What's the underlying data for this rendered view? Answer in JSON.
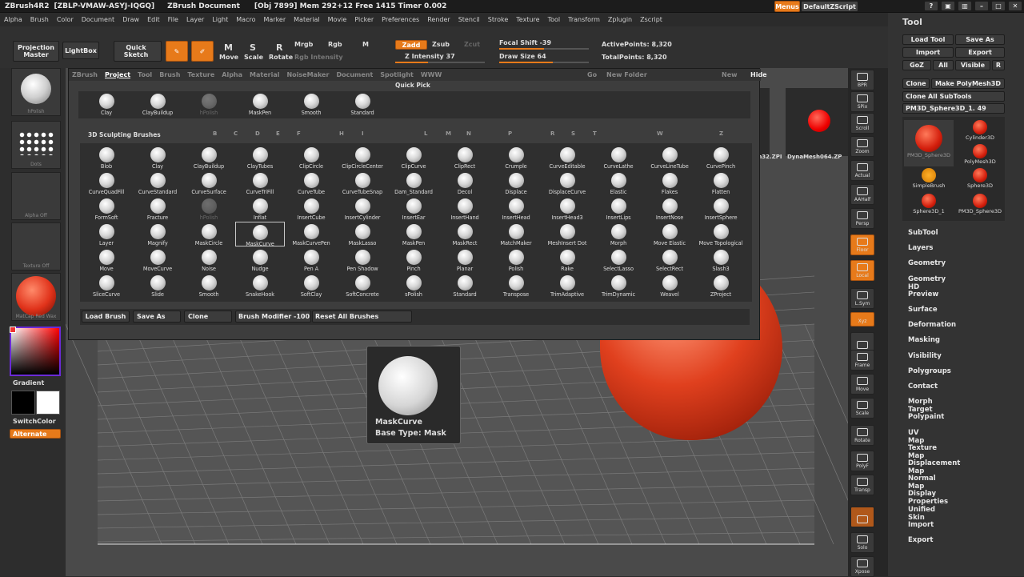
{
  "titlebar": {
    "app": "ZBrush4R2",
    "serial": "[ZBLP-VMAW-ASYJ-IQGQ]",
    "document": "ZBrush Document",
    "stats": "[Obj 7899] Mem 292+12 Free 1415 Timer 0.002",
    "menus_btn": "Menus",
    "script": "DefaultZScript"
  },
  "menubar": [
    "Alpha",
    "Brush",
    "Color",
    "Document",
    "Draw",
    "Edit",
    "File",
    "Layer",
    "Light",
    "Macro",
    "Marker",
    "Material",
    "Movie",
    "Picker",
    "Preferences",
    "Render",
    "Stencil",
    "Stroke",
    "Texture",
    "Tool",
    "Transform",
    "Zplugin",
    "Zscript"
  ],
  "toolbar": {
    "projection_master": "Projection Master",
    "lightbox": "LightBox",
    "quick_sketch": "Quick Sketch",
    "edit": "Edit",
    "draw": "Draw",
    "move": "Move",
    "scale": "Scale",
    "rotate": "Rotate",
    "mrgb": "Mrgb",
    "rgb": "Rgb",
    "m": "M",
    "rgb_intensity": "Rgb Intensity",
    "zadd": "Zadd",
    "zsub": "Zsub",
    "zcut": "Zcut",
    "z_intensity": "Z Intensity 37",
    "focal_shift": "Focal Shift -39",
    "draw_size": "Draw Size 64",
    "active_points": "ActivePoints: 8,320",
    "total_points": "TotalPoints: 8,320"
  },
  "leftshelf": {
    "brush_caption": "hPolish",
    "stroke_caption": "Dots",
    "alpha_caption": "Alpha Off",
    "texture_caption": "Texture Off",
    "material_caption": "MatCap Red Wax",
    "gradient": "Gradient",
    "switch_color": "SwitchColor",
    "alternate": "Alternate"
  },
  "lightbox_tabs": [
    "ZBrush",
    "Project",
    "Tool",
    "Brush",
    "Texture",
    "Alpha",
    "Material",
    "NoiseMaker",
    "Document",
    "Spotlight",
    "WWW"
  ],
  "lightbox_right": [
    "Go",
    "New Folder",
    "New",
    "Hide"
  ],
  "picker": {
    "quick_pick_title": "Quick Pick",
    "quick_pick": [
      "Clay",
      "ClayBuildup",
      "hPolish",
      "MaskPen",
      "Smooth",
      "Standard"
    ],
    "section_title": "3D Sculpting Brushes",
    "letters": [
      "B",
      "C",
      "D",
      "E",
      "F",
      "H",
      "I",
      "L",
      "M",
      "N",
      "P",
      "R",
      "S",
      "T",
      "W",
      "Z"
    ],
    "brushes": [
      [
        "Blob",
        "Clay",
        "ClayBuildup",
        "ClayTubes",
        "ClipCircle",
        "ClipCircleCenter",
        "ClipCurve",
        "ClipRect",
        "Crumple",
        "CurveEditable",
        "CurveLathe",
        "CurveLineTube",
        "CurvePinch"
      ],
      [
        "CurveQuadFill",
        "CurveStandard",
        "CurveSurface",
        "CurveTriFill",
        "CurveTube",
        "CurveTubeSnap",
        "Dam_Standard",
        "Decol",
        "Displace",
        "DisplaceCurve",
        "Elastic",
        "Flakes",
        "Flatten"
      ],
      [
        "FormSoft",
        "Fracture",
        "hPolish",
        "Inflat",
        "InsertCube",
        "InsertCylinder",
        "InsertEar",
        "InsertHand",
        "InsertHead",
        "InsertHead3",
        "InsertLips",
        "InsertNose",
        "InsertSphere"
      ],
      [
        "Layer",
        "Magnify",
        "MaskCircle",
        "MaskCurve",
        "MaskCurvePen",
        "MaskLasso",
        "MaskPen",
        "MaskRect",
        "MatchMaker",
        "MeshInsert Dot",
        "Morph",
        "Move Elastic",
        "Move Topological"
      ],
      [
        "Move",
        "MoveCurve",
        "Noise",
        "Nudge",
        "Pen A",
        "Pen Shadow",
        "Pinch",
        "Planar",
        "Polish",
        "Rake",
        "SelectLasso",
        "SelectRect",
        "Slash3"
      ],
      [
        "SliceCurve",
        "Slide",
        "Smooth",
        "SnakeHook",
        "SoftClay",
        "SoftConcrete",
        "sPolish",
        "Standard",
        "Transpose",
        "TrimAdaptive",
        "TrimDynamic",
        "Weavel",
        "ZProject"
      ]
    ],
    "bottom": {
      "load_brush": "Load Brush",
      "save_as": "Save As",
      "clone": "Clone",
      "brush_modifier": "Brush Modifier -100",
      "reset_all": "Reset All Brushes"
    }
  },
  "tooltip": {
    "name": "MaskCurve",
    "base_type": "Base Type: Mask"
  },
  "viewport_files": {
    "file_a": "...m32.ZPI",
    "file_b": "DynaMesh064.ZP"
  },
  "rightshelf": [
    "BPR",
    "SPix",
    "Scroll",
    "Zoom",
    "Actual",
    "AAHalf",
    "Persp",
    "Floor",
    "Local",
    "L.Sym",
    "Xyz",
    "",
    "Frame",
    "Move",
    "Scale",
    "Rotate",
    "PolyF",
    "Transp",
    "",
    "Solo",
    "Xpose"
  ],
  "tool_panel": {
    "title": "Tool",
    "load_tool": "Load Tool",
    "save_as": "Save As",
    "import": "Import",
    "export": "Export",
    "goz": "GoZ",
    "all": "All",
    "visible": "Visible",
    "r": "R",
    "clone": "Clone",
    "make_polymesh": "Make PolyMesh3D",
    "clone_all": "Clone All SubTools",
    "current_tool": "PM3D_Sphere3D_1. 49",
    "tools": [
      "PM3D_Sphere3D",
      "Cylinder3D",
      "PolyMesh3D",
      "SimpleBrush",
      "Sphere3D",
      "Sphere3D_1",
      "PM3D_Sphere3D"
    ],
    "menu": [
      "SubTool",
      "Layers",
      "Geometry",
      "Geometry HD",
      "Preview",
      "Surface",
      "Deformation",
      "Masking",
      "Visibility",
      "Polygroups",
      "Contact",
      "Morph Target",
      "Polypaint",
      "UV Map",
      "Texture Map",
      "Displacement Map",
      "Normal Map",
      "Display Properties",
      "Unified Skin",
      "Import",
      "Export"
    ]
  },
  "colors": {
    "accent": "#e77a1a",
    "model_red": "#d8371c"
  }
}
